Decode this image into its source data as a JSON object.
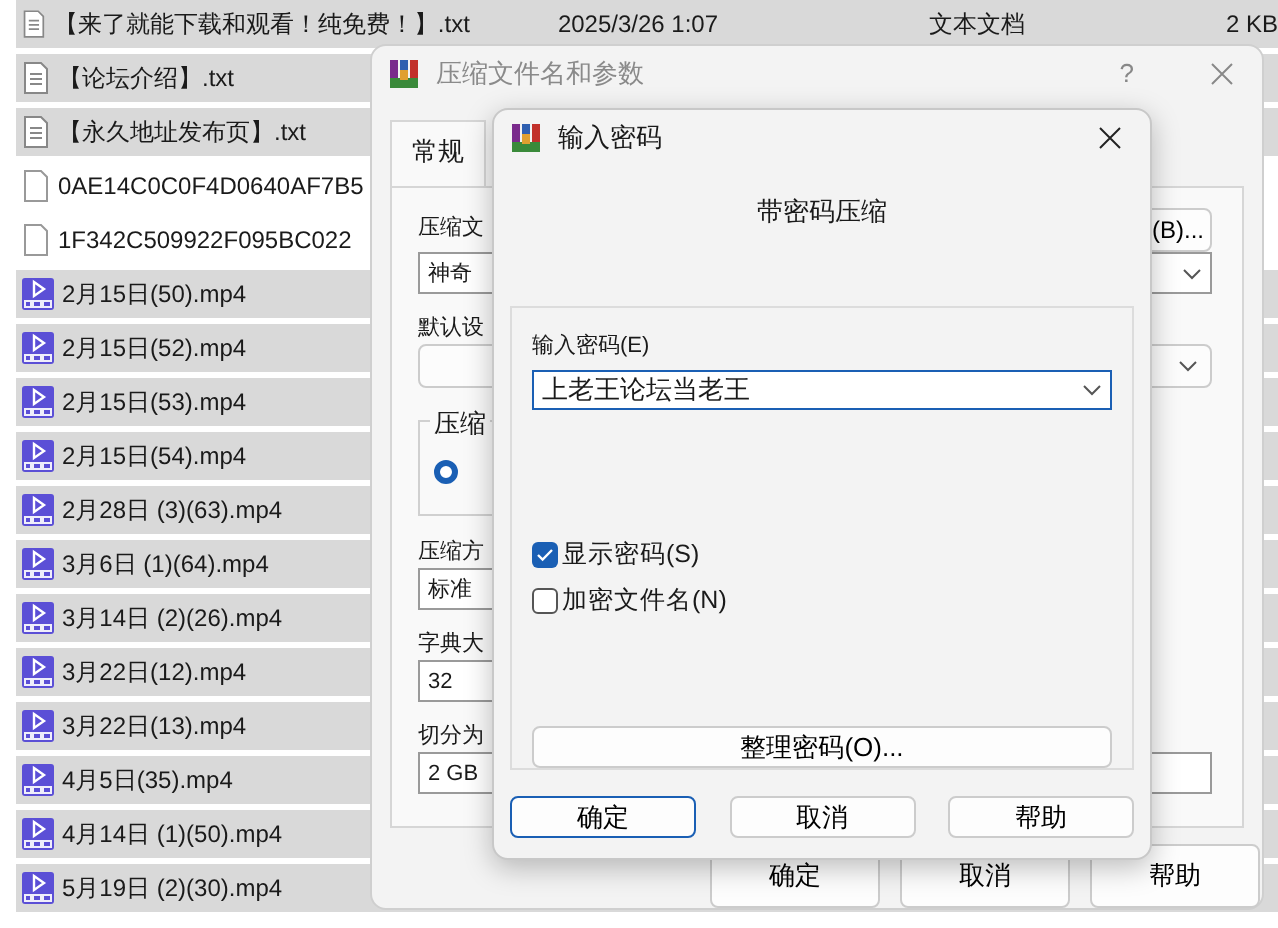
{
  "files": [
    {
      "name": "【来了就能下载和观看！纯免费！】.txt",
      "kind": "text",
      "selected": true,
      "date": "2025/3/26 1:07",
      "type": "文本文档",
      "size": "2 KB"
    },
    {
      "name": "【论坛介绍】.txt",
      "kind": "text",
      "selected": true
    },
    {
      "name": "【永久地址发布页】.txt",
      "kind": "text",
      "selected": true
    },
    {
      "name": "0AE14C0C0F4D0640AF7B5",
      "kind": "blank",
      "selected": false
    },
    {
      "name": "1F342C509922F095BC022",
      "kind": "blank",
      "selected": false
    },
    {
      "name": "2月15日(50).mp4",
      "kind": "video",
      "selected": true
    },
    {
      "name": "2月15日(52).mp4",
      "kind": "video",
      "selected": true
    },
    {
      "name": "2月15日(53).mp4",
      "kind": "video",
      "selected": true
    },
    {
      "name": "2月15日(54).mp4",
      "kind": "video",
      "selected": true
    },
    {
      "name": "2月28日 (3)(63).mp4",
      "kind": "video",
      "selected": true
    },
    {
      "name": "3月6日 (1)(64).mp4",
      "kind": "video",
      "selected": true
    },
    {
      "name": "3月14日 (2)(26).mp4",
      "kind": "video",
      "selected": true
    },
    {
      "name": "3月22日(12).mp4",
      "kind": "video",
      "selected": true
    },
    {
      "name": "3月22日(13).mp4",
      "kind": "video",
      "selected": true
    },
    {
      "name": "4月5日(35).mp4",
      "kind": "video",
      "selected": true
    },
    {
      "name": "4月14日 (1)(50).mp4",
      "kind": "video",
      "selected": true
    },
    {
      "name": "5月19日 (2)(30).mp4",
      "kind": "video",
      "selected": true
    }
  ],
  "archive_dialog": {
    "title": "压缩文件名和参数",
    "help": "?",
    "tab": {
      "label": "常规",
      "selected": true
    },
    "browse_button": "(B)...",
    "archive_name": {
      "label": "压缩文",
      "value": "神奇"
    },
    "profile": {
      "label": "默认设"
    },
    "format_group": {
      "title": "压缩",
      "option_selected": true
    },
    "method": {
      "label": "压缩方",
      "value": "标准"
    },
    "dictionary": {
      "label": "字典大",
      "value": "32"
    },
    "split": {
      "label": "切分为",
      "value": "2 GB"
    },
    "buttons": [
      "确定",
      "取消",
      "帮助"
    ]
  },
  "password_dialog": {
    "title": "输入密码",
    "heading": "带密码压缩",
    "password_label": "输入密码(E)",
    "password": "上老王论坛当老王",
    "options": [
      {
        "label": "显示密码(S)",
        "checked": true
      },
      {
        "label": "加密文件名(N)",
        "checked": false
      }
    ],
    "organize_button": "整理密码(O)...",
    "buttons": [
      {
        "label": "确定",
        "default": true
      },
      {
        "label": "取消",
        "default": false
      },
      {
        "label": "帮助",
        "default": false
      }
    ]
  }
}
